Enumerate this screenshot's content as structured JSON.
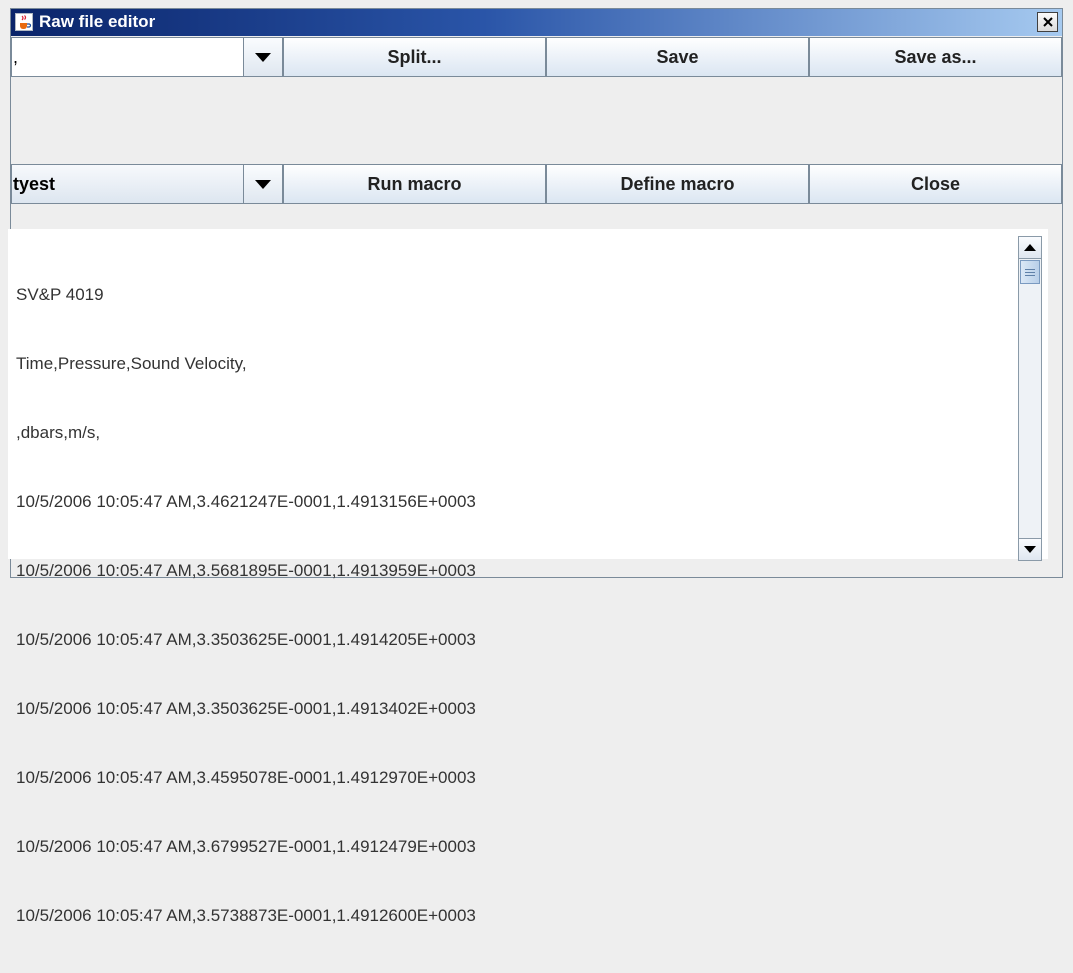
{
  "window": {
    "title": "Raw file editor",
    "icon": "java-cup-icon",
    "close_glyph": "✕"
  },
  "toolbar1": {
    "delimiter_value": ",",
    "split_label": "Split...",
    "save_label": "Save",
    "save_as_label": "Save as..."
  },
  "toolbar2": {
    "macro_value": "tyest",
    "run_macro_label": "Run macro",
    "define_macro_label": "Define macro",
    "close_label": "Close"
  },
  "editor": {
    "lines": [
      "SV&P 4019",
      "Time,Pressure,Sound Velocity,",
      ",dbars,m/s,",
      "10/5/2006 10:05:47 AM,3.4621247E-0001,1.4913156E+0003",
      "10/5/2006 10:05:47 AM,3.5681895E-0001,1.4913959E+0003",
      "10/5/2006 10:05:47 AM,3.3503625E-0001,1.4914205E+0003",
      "10/5/2006 10:05:47 AM,3.3503625E-0001,1.4913402E+0003",
      "10/5/2006 10:05:47 AM,3.4595078E-0001,1.4912970E+0003",
      "10/5/2006 10:05:47 AM,3.6799527E-0001,1.4912479E+0003",
      "10/5/2006 10:05:47 AM,3.5738873E-0001,1.4912600E+0003"
    ]
  }
}
